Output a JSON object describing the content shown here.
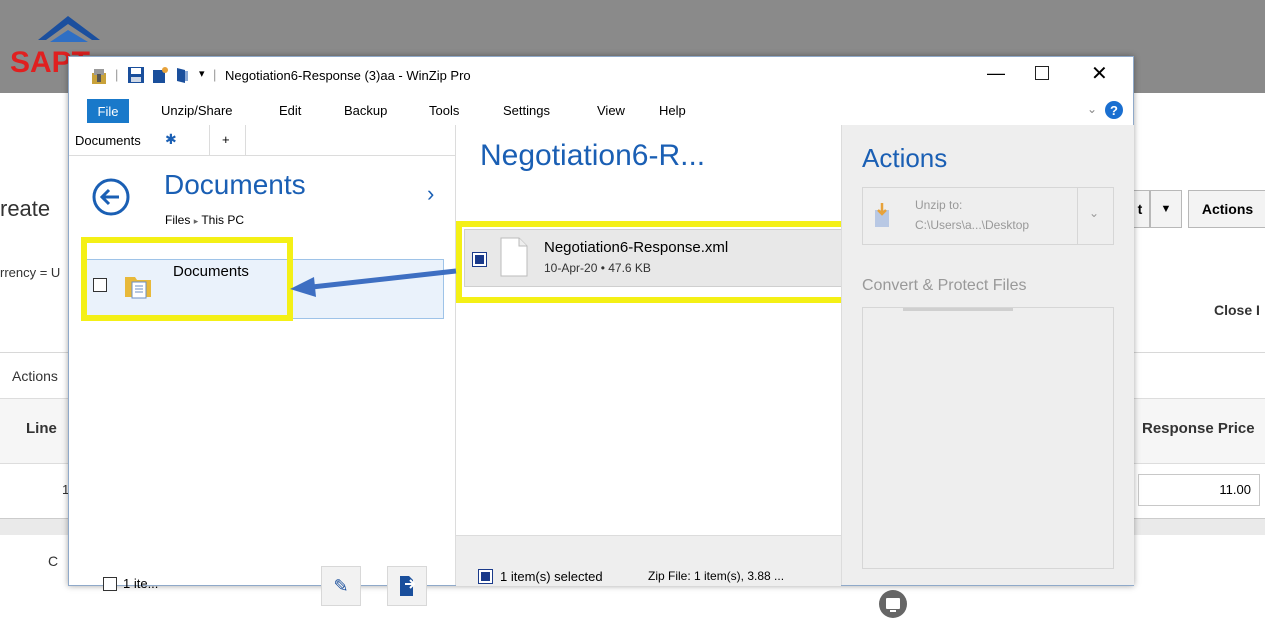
{
  "background": {
    "logo_text": "SAPT",
    "reate": "reate",
    "rrency": "rrency = U",
    "close": "Close I",
    "actions_tab": "Actions",
    "line_header": "Line",
    "response_price_header": "Response Price",
    "price_value": "11.00",
    "row_number": "1",
    "bottom_c": "C",
    "actions_button": "Actions",
    "t_button": "t"
  },
  "window": {
    "title": "Negotiation6-Response (3)aa - WinZip Pro",
    "menu": [
      "File",
      "Unzip/Share",
      "Edit",
      "Backup",
      "Tools",
      "Settings",
      "View",
      "Help"
    ]
  },
  "left_pane": {
    "tab_label": "Documents",
    "tab_add": "+",
    "folder_title": "Documents",
    "breadcrumb_files": "Files",
    "breadcrumb_sep": "▸",
    "breadcrumb_pc": "This PC",
    "folder_item": "Documents",
    "footer_count": "1 ite..."
  },
  "mid_pane": {
    "zip_title": "Negotiation6-R...",
    "file_name": "Negotiation6-Response.xml",
    "file_meta": "10-Apr-20 • 47.6 KB",
    "footer_selected": "1 item(s) selected",
    "footer_zip": "Zip File: 1 item(s), 3.88 ..."
  },
  "right_pane": {
    "title": "Actions",
    "unzip_to_label": "Unzip to:",
    "unzip_to_path": "C:\\Users\\a...\\Desktop",
    "convert_label": "Convert & Protect Files"
  },
  "colors": {
    "highlight": "#f4f016",
    "arrow": "#3e6fc2",
    "file_menu": "#1979ca",
    "accent_blue": "#1a5fb4"
  }
}
